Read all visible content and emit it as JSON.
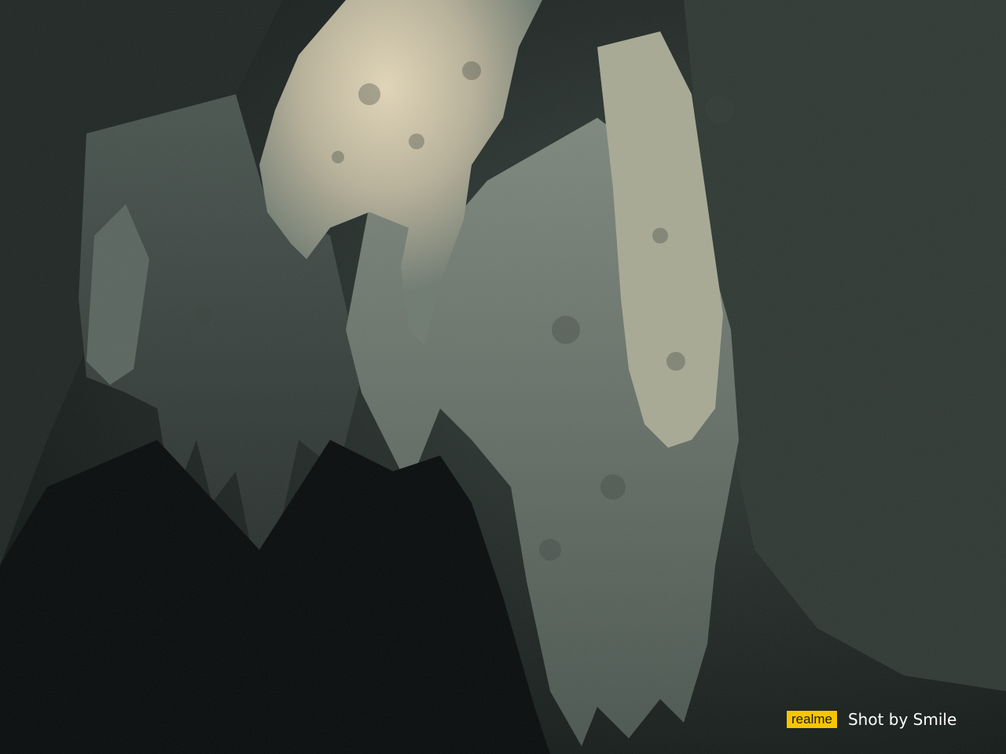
{
  "photo": {
    "subject": "cave-stalactites",
    "palette": {
      "shadow": "#0b0f0e",
      "rock_dark": "#2c3532",
      "rock_mid": "#5e6a63",
      "rock_light": "#9aa296",
      "highlight": "#d9ccae"
    }
  },
  "watermark": {
    "brand": "realme",
    "caption": "Shot by Smile",
    "badge_color": "#f7c500"
  }
}
